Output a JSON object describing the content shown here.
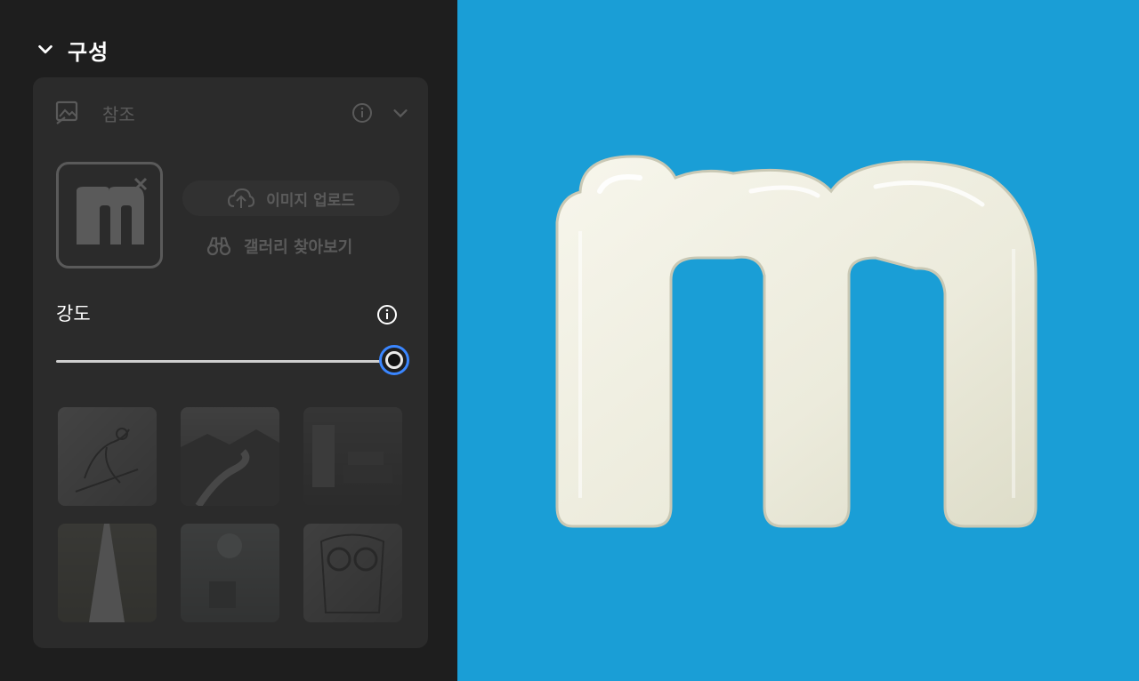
{
  "section": {
    "title": "구성",
    "icon": "chevron-down-icon"
  },
  "reference": {
    "label": "참조",
    "icons": [
      "image-reference-icon",
      "info-icon",
      "chevron-down-icon"
    ],
    "upload_button": "이미지 업로드",
    "gallery_link": "갤러리 찾아보기"
  },
  "strength": {
    "label": "강도",
    "value_fraction": 1.0
  },
  "gallery_thumbnails": [
    "bird-sketch-thumbnail",
    "river-landscape-thumbnail",
    "interior-room-thumbnail",
    "road-perspective-thumbnail",
    "sphere-on-cube-thumbnail",
    "owl-sketch-thumbnail"
  ],
  "colors": {
    "accent": "#3a86ff",
    "canvas_background": "#1a9ed6",
    "panel": "#1e1e1e",
    "card": "#2b2b2b",
    "letter": "#efeee0"
  }
}
